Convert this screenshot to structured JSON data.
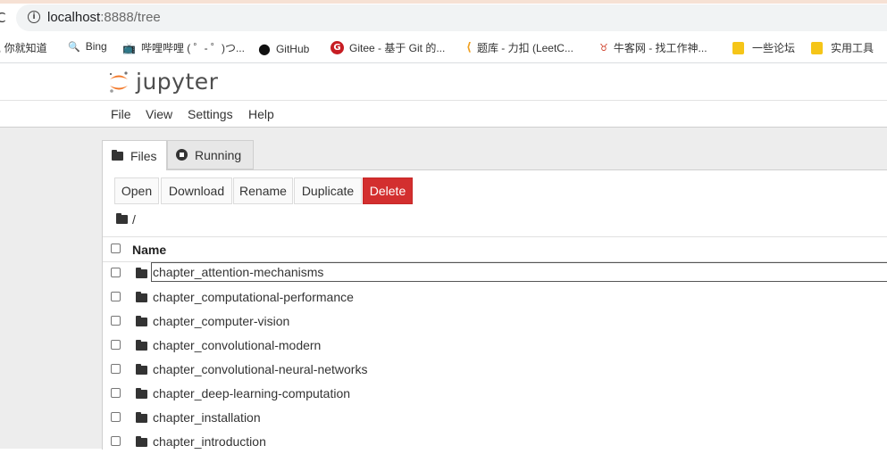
{
  "browser": {
    "url_host": "localhost",
    "url_path": ":8888/tree",
    "reload_glyph": "C",
    "info_glyph": "i",
    "bookmarks": [
      {
        "label": ", 你就知道",
        "icon": ""
      },
      {
        "label": "Bing",
        "icon": "search-icon",
        "glyph": "🔍",
        "color": "#1a73e8"
      },
      {
        "label": "哔哩哔哩 ( ゜- ゜)つ...",
        "icon": "bilibili-icon",
        "glyph": "📺",
        "color": "#00a1d6"
      },
      {
        "label": "GitHub",
        "icon": "github-icon",
        "glyph": "●",
        "color": "#111111"
      },
      {
        "label": "Gitee - 基于 Git 的...",
        "icon": "gitee-icon",
        "glyph": "G",
        "color": "#c71d23"
      },
      {
        "label": "题库 - 力扣 (LeetC...",
        "icon": "leetcode-icon",
        "glyph": "⟨",
        "color": "#f0a020"
      },
      {
        "label": "牛客网 - 找工作神...",
        "icon": "nowcoder-icon",
        "glyph": "♉",
        "color": "#d0402a"
      },
      {
        "label": "一些论坛",
        "icon": "folder-icon"
      },
      {
        "label": "实用工具",
        "icon": "folder-icon"
      }
    ]
  },
  "app": {
    "name": "jupyter",
    "menu": [
      "File",
      "View",
      "Settings",
      "Help"
    ],
    "tabs": [
      {
        "label": "Files",
        "active": true
      },
      {
        "label": "Running",
        "active": false
      }
    ],
    "toolbar": {
      "open": "Open",
      "download": "Download",
      "rename": "Rename",
      "duplicate": "Duplicate",
      "delete": "Delete"
    },
    "breadcrumb": "/",
    "list_header": "Name",
    "files": [
      "chapter_attention-mechanisms",
      "chapter_computational-performance",
      "chapter_computer-vision",
      "chapter_convolutional-modern",
      "chapter_convolutional-neural-networks",
      "chapter_deep-learning-computation",
      "chapter_installation",
      "chapter_introduction"
    ],
    "selected_index": 0
  },
  "colors": {
    "jupyter_orange": "#f37726",
    "delete_red": "#d32f2f",
    "panel_bg": "#ededed"
  }
}
